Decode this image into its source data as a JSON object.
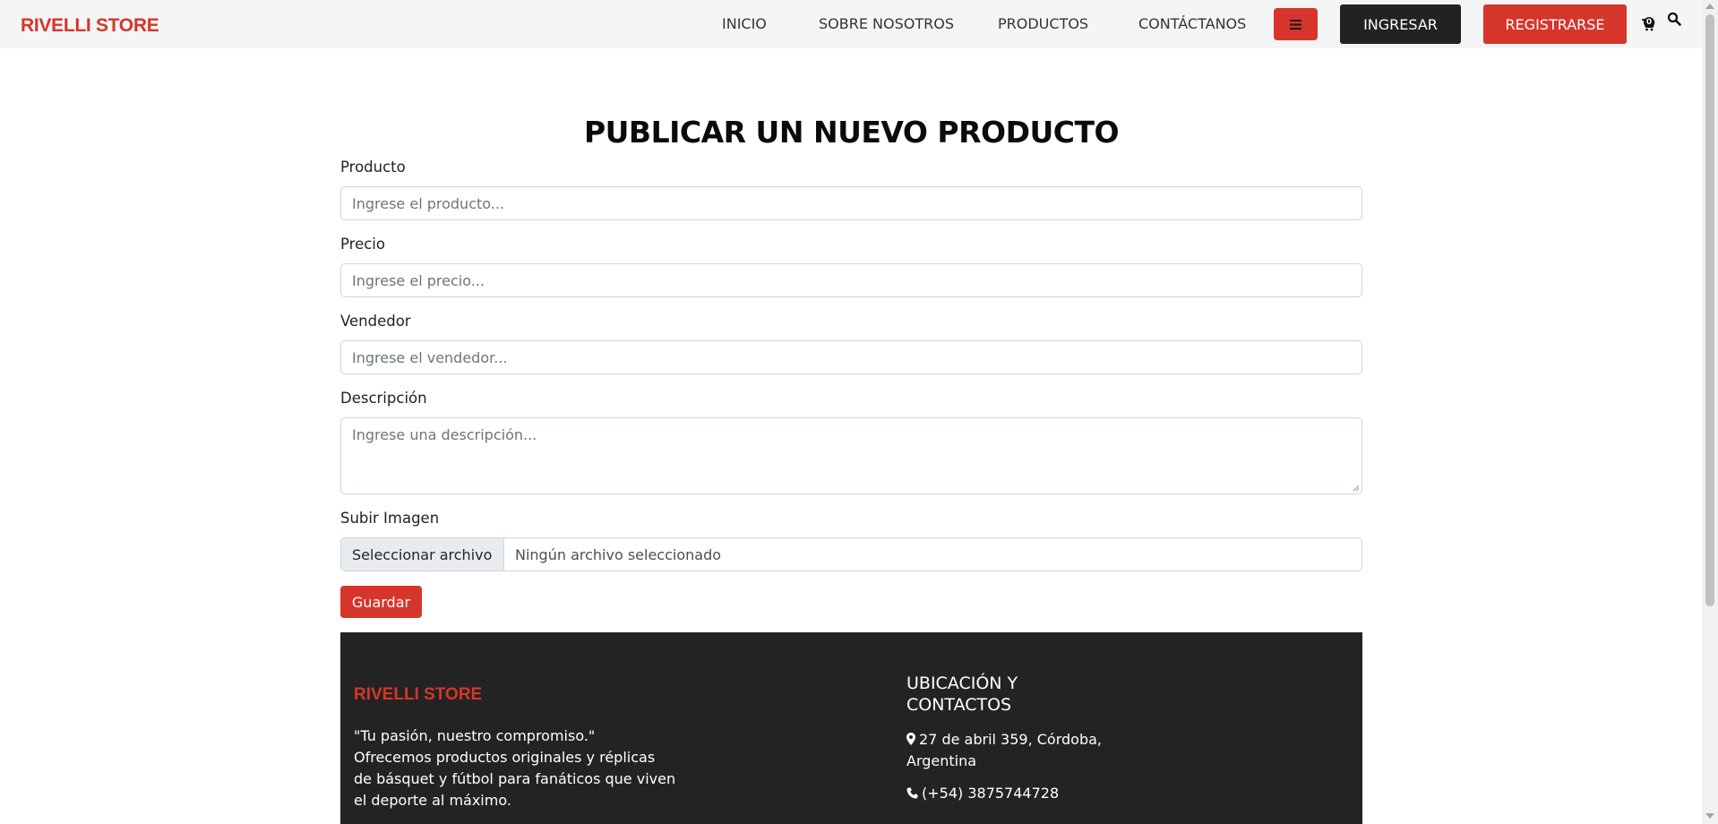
{
  "navbar": {
    "brand": "RIVELLI STORE",
    "links": [
      "INICIO",
      "SOBRE NOSOTROS",
      "PRODUCTOS",
      "CONTÁCTANOS"
    ],
    "login_label": "INGRESAR",
    "register_label": "REGISTRARSE",
    "cart_count": "0"
  },
  "form": {
    "title": "PUBLICAR UN NUEVO PRODUCTO",
    "fields": [
      {
        "label": "Producto",
        "placeholder": "Ingrese el producto..."
      },
      {
        "label": "Precio",
        "placeholder": "Ingrese el precio..."
      },
      {
        "label": "Vendedor",
        "placeholder": "Ingrese el vendedor..."
      },
      {
        "label": "Descripción",
        "placeholder": "Ingrese una descripción..."
      }
    ],
    "image": {
      "label": "Subir Imagen",
      "button_label": "Seleccionar archivo",
      "status": "Ningún archivo seleccionado"
    },
    "save_label": "Guardar"
  },
  "footer": {
    "brand": "RIVELLI STORE",
    "text": "\"Tu pasión, nuestro compromiso.\" Ofrecemos productos originales y réplicas de básquet y fútbol para fanáticos que viven el deporte al máximo.",
    "contact_heading": "UBICACIÓN Y CONTACTOS",
    "address": "27 de abril 359, Córdoba, Argentina",
    "phone": "(+54) 3875744728"
  },
  "colors": {
    "accent": "#d6352b",
    "dark": "#222222",
    "navbar_bg": "#f4f5f5",
    "footer_bg": "#232323"
  },
  "icons": [
    "menu-icon",
    "cart-icon",
    "search-icon",
    "map-marker-icon",
    "phone-icon"
  ]
}
